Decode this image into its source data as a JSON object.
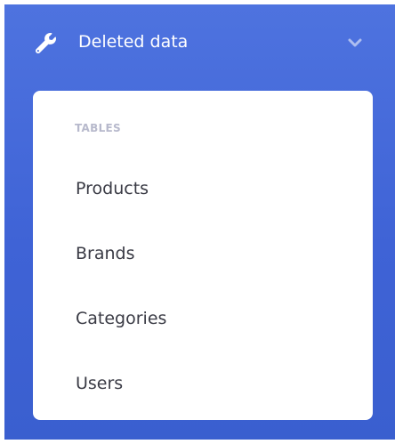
{
  "nav": {
    "label": "Deleted data",
    "icon": "wrench-icon",
    "toggle_icon": "chevron-down-icon"
  },
  "collapse": {
    "header": "TABLES",
    "items": [
      {
        "label": "Products"
      },
      {
        "label": "Brands"
      },
      {
        "label": "Categories"
      },
      {
        "label": "Users"
      }
    ]
  },
  "colors": {
    "sidebar": "#4e73df",
    "card": "#ffffff",
    "header_text": "#b7b9cc",
    "item_text": "#3a3b45"
  }
}
